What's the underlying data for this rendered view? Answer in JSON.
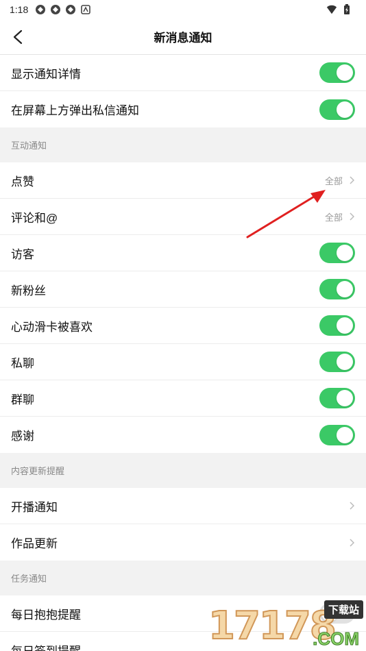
{
  "status_bar": {
    "time": "1:18"
  },
  "header": {
    "title": "新消息通知"
  },
  "top_rows": [
    {
      "label": "显示通知详情",
      "toggle": true
    },
    {
      "label": "在屏幕上方弹出私信通知",
      "toggle": true
    }
  ],
  "sections": {
    "interaction": {
      "title": "互动通知",
      "rows": [
        {
          "label": "点赞",
          "value": "全部"
        },
        {
          "label": "评论和@",
          "value": "全部"
        },
        {
          "label": "访客",
          "toggle": true
        },
        {
          "label": "新粉丝",
          "toggle": true
        },
        {
          "label": "心动滑卡被喜欢",
          "toggle": true
        },
        {
          "label": "私聊",
          "toggle": true
        },
        {
          "label": "群聊",
          "toggle": true
        },
        {
          "label": "感谢",
          "toggle": true
        }
      ]
    },
    "content": {
      "title": "内容更新提醒",
      "rows": [
        {
          "label": "开播通知"
        },
        {
          "label": "作品更新"
        }
      ]
    },
    "tasks": {
      "title": "任务通知",
      "rows": [
        {
          "label": "每日抱抱提醒",
          "toggle": false
        },
        {
          "label": "每日签到提醒"
        }
      ]
    }
  },
  "watermark": {
    "digits": "17178",
    "badge": "下载站",
    "suffix": ".COM"
  },
  "colors": {
    "toggle_on": "#3bc966",
    "toggle_off": "#e1e1e1",
    "arrow": "#e02020"
  }
}
